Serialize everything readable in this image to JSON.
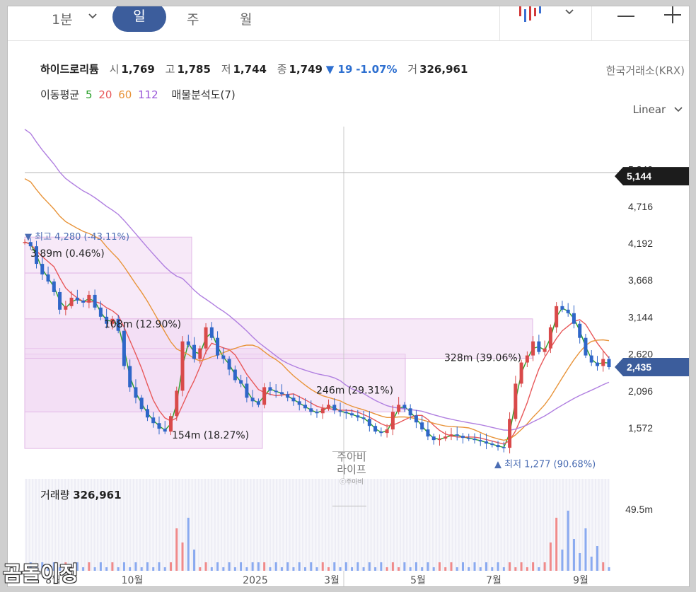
{
  "topbar": {
    "interval": "1분",
    "tabs": [
      "일",
      "주",
      "월"
    ],
    "active_tab": "일"
  },
  "stock": {
    "name": "하이드로리튬",
    "open_label": "시",
    "open": "1,769",
    "high_label": "고",
    "high": "1,785",
    "low_label": "저",
    "low": "1,744",
    "close_label": "종",
    "close": "1,749",
    "change": "▼ 19",
    "change_pct": "-1.07%",
    "volume_label": "거",
    "volume": "326,961",
    "exchange": "한국거래소(KRX)"
  },
  "indicators": {
    "ma_label": "이동평균",
    "ma": [
      {
        "period": "5",
        "color": "#2aa02a"
      },
      {
        "period": "20",
        "color": "#e8585a"
      },
      {
        "period": "60",
        "color": "#e8943a"
      },
      {
        "period": "112",
        "color": "#9b59d9"
      }
    ],
    "volume_profile": "매물분석도(7)"
  },
  "scale": "Linear",
  "chart_data": {
    "type": "candlestick",
    "y_axis_ticks": [
      5240,
      4716,
      4192,
      3668,
      3144,
      2620,
      2096,
      1572
    ],
    "y_axis_tick_labels": [
      "5,240",
      "4,716",
      "4,192",
      "3,668",
      "3,144",
      "2,620",
      "2,096",
      "1,572"
    ],
    "x_axis_labels": [
      "8월",
      "10월",
      "2025",
      "3월",
      "5월",
      "7월",
      "9월"
    ],
    "price_tags": [
      {
        "label": "5,144",
        "value": 5144,
        "color": "#1c1c1c"
      },
      {
        "label": "2,435",
        "value": 2435,
        "color": "#3c5d9c"
      }
    ],
    "high_marker": {
      "text": "▼ 최고 4,280 (-43.11%)",
      "value": 4280
    },
    "low_marker": {
      "text": "▲ 최저 1,277 (90.68%)",
      "value": 1277
    },
    "volume_profile": [
      {
        "label": "3.89m (0.46%)",
        "low": 3770,
        "high": 4280
      },
      {
        "label": "108m (12.90%)",
        "low": 2700,
        "high": 3770
      },
      {
        "label": "154m (18.27%)",
        "low": 1280,
        "high": 2700
      },
      {
        "label": "246m (29.31%)",
        "low": 1800,
        "high": 2620
      },
      {
        "label": "328m (39.06%)",
        "low": 2560,
        "high": 3120
      }
    ],
    "close_series_approx": [
      4210,
      4150,
      3900,
      3750,
      3650,
      3500,
      3250,
      3300,
      3420,
      3380,
      3350,
      3460,
      3280,
      3150,
      3050,
      3120,
      2950,
      2450,
      2150,
      2000,
      1840,
      1720,
      1640,
      1560,
      1520,
      1740,
      2100,
      2800,
      2750,
      2550,
      2700,
      3000,
      2850,
      2600,
      2550,
      2400,
      2250,
      2200,
      2000,
      1950,
      1900,
      2150,
      2100,
      2080,
      2050,
      2000,
      1950,
      1900,
      1850,
      1800,
      1780,
      1850,
      1900,
      1820,
      1800,
      1780,
      1750,
      1720,
      1700,
      1600,
      1520,
      1500,
      1550,
      1800,
      1900,
      1850,
      1750,
      1650,
      1550,
      1450,
      1400,
      1420,
      1450,
      1480,
      1460,
      1430,
      1420,
      1400,
      1380,
      1350,
      1330,
      1300,
      1290,
      1700,
      2200,
      2500,
      2600,
      2800,
      2650,
      2700,
      3000,
      3300,
      3250,
      3200,
      3050,
      2850,
      2600,
      2500,
      2450,
      2550,
      2435
    ],
    "volume_title": "거래량",
    "volume_value": "326,961",
    "volume_axis_label": "49.5m"
  },
  "watermark": {
    "line1": "주아비",
    "line2": "라이프",
    "line3": "ⓒ주아비"
  },
  "signature": "곰돌이정"
}
